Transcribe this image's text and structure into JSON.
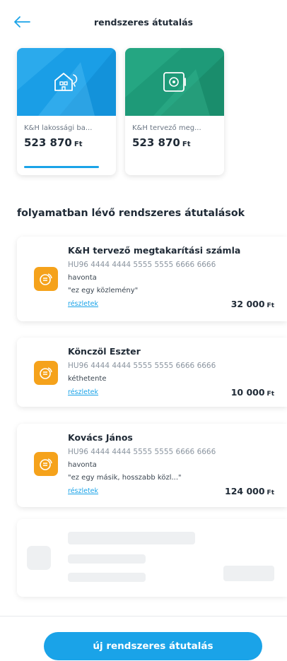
{
  "header": {
    "title": "rendszeres átutalás"
  },
  "accounts": [
    {
      "name": "K&H lakossági ba...",
      "amount": "523 870",
      "currency": "Ft",
      "selected": true
    },
    {
      "name": "K&H tervező meg...",
      "amount": "523 870",
      "currency": "Ft",
      "selected": false
    }
  ],
  "section_title": "folyamatban lévő rendszeres átutalások",
  "transfers": [
    {
      "name": "K&H tervező megtakarítási számla",
      "iban": "HU96 4444 4444 5555 5555 6666 6666",
      "frequency": "havonta",
      "note": "\"ez egy közlemény\"",
      "link": "részletek",
      "amount": "32 000",
      "currency": "Ft"
    },
    {
      "name": "Könczöl Eszter",
      "iban": "HU96 4444 4444 5555 5555 6666 6666",
      "frequency": "kéthetente",
      "link": "részletek",
      "amount": "10 000",
      "currency": "Ft"
    },
    {
      "name": "Kovács János",
      "iban": "HU96 4444 4444 5555 5555 6666 6666",
      "frequency": "havonta",
      "note": "\"ez egy másik, hosszabb közl...\"",
      "link": "részletek",
      "amount": "124 000",
      "currency": "Ft"
    }
  ],
  "cta": {
    "label": "új rendszeres átutalás"
  },
  "colors": {
    "accent": "#1aa3e8",
    "account1": "#1a9ee6",
    "account2": "#1e9a78",
    "badge": "#f5a21b"
  },
  "icons": {
    "back": "arrow-left-icon",
    "account1": "house-icon",
    "account2": "safe-icon",
    "transfer": "coins-icon"
  }
}
